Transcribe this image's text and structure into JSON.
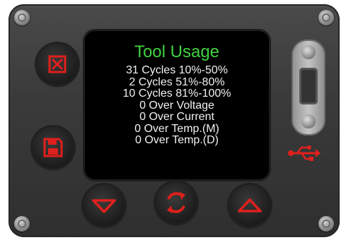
{
  "screen": {
    "title": "Tool Usage",
    "lines": [
      "31 Cycles 10%-50%",
      "2 Cycles 51%-80%",
      "10 Cycles 81%-100%",
      "0 Over Voltage",
      "0 Over Current",
      "0 Over Temp.(M)",
      "0 Over Temp.(D)"
    ]
  },
  "colors": {
    "panel": "#3a3a3a",
    "title": "#3fd13f",
    "text": "#f2f2f2",
    "accent": "#e0201c"
  },
  "buttons": {
    "cancel": "close-icon",
    "save": "save-icon",
    "down": "arrow-down-icon",
    "refresh": "refresh-icon",
    "up": "arrow-up-icon"
  },
  "usb_icon": "usb-icon"
}
